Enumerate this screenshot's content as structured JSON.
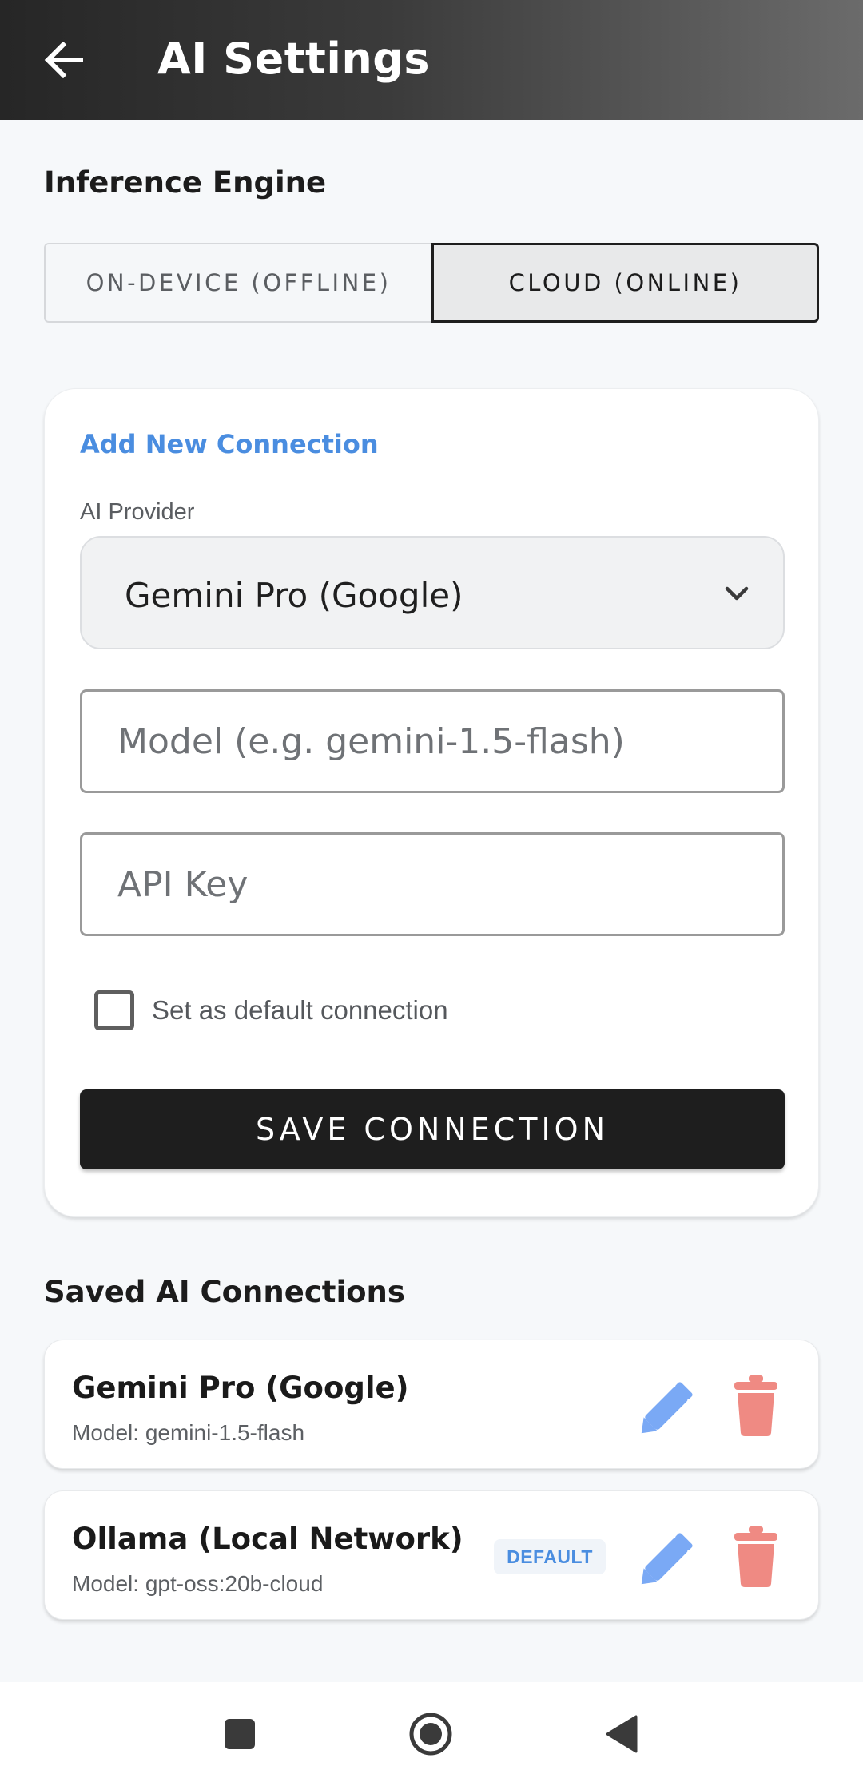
{
  "app_bar": {
    "title": "AI Settings",
    "back_icon": "arrow-left-icon"
  },
  "inference_engine": {
    "title": "Inference Engine",
    "options": [
      {
        "label": "ON-DEVICE (OFFLINE)",
        "selected": false
      },
      {
        "label": "CLOUD (ONLINE)",
        "selected": true
      }
    ]
  },
  "new_connection": {
    "heading": "Add New Connection",
    "provider_label": "AI Provider",
    "provider_value": "Gemini Pro (Google)",
    "model_placeholder": "Model (e.g. gemini-1.5-flash)",
    "model_value": "",
    "api_key_placeholder": "API Key",
    "api_key_value": "",
    "default_checkbox_label": "Set as default connection",
    "default_checked": false,
    "save_label": "SAVE CONNECTION"
  },
  "saved": {
    "title": "Saved AI Connections",
    "connections": [
      {
        "name": "Gemini Pro (Google)",
        "model": "Model: gemini-1.5-flash",
        "badge": ""
      },
      {
        "name": "Ollama (Local Network)",
        "model": "Model: gpt-oss:20b-cloud",
        "badge": "DEFAULT"
      }
    ]
  },
  "colors": {
    "accent_blue": "#4a8de0",
    "edit_icon": "#7aa9f5",
    "delete_icon": "#ef8a83",
    "primary_dark": "#1e1e1e"
  },
  "nav_bar": {
    "icons": [
      "square-recents-icon",
      "circle-home-icon",
      "triangle-back-icon"
    ]
  }
}
